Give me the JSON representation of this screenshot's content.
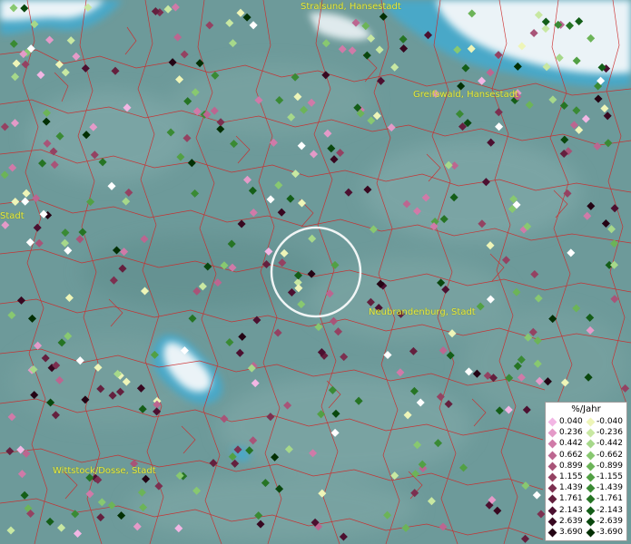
{
  "cities": [
    {
      "name": "Stralsund, Hansestadt"
    },
    {
      "name": "Greifswald, Hansestadt"
    },
    {
      "name": "Neubrandenburg, Stadt"
    },
    {
      "name": "Wittstock/Dosse, Stadt"
    },
    {
      "name": "Stadt"
    }
  ],
  "legend": {
    "title": "%/Jahr",
    "rows": [
      {
        "pos": "0.040",
        "neg": "-0.040",
        "pos_color": "#f2b6e4",
        "neg_color": "#eef5b8"
      },
      {
        "pos": "0.236",
        "neg": "-0.236",
        "pos_color": "#e49ac8",
        "neg_color": "#c8e8a2"
      },
      {
        "pos": "0.442",
        "neg": "-0.442",
        "pos_color": "#d07aa8",
        "neg_color": "#a6d88a"
      },
      {
        "pos": "0.662",
        "neg": "-0.662",
        "pos_color": "#bc6690",
        "neg_color": "#88c870"
      },
      {
        "pos": "0.899",
        "neg": "-0.899",
        "pos_color": "#a85478",
        "neg_color": "#6cb458"
      },
      {
        "pos": "1.155",
        "neg": "-1.155",
        "pos_color": "#944262",
        "neg_color": "#52a044"
      },
      {
        "pos": "1.439",
        "neg": "-1.439",
        "pos_color": "#7c3050",
        "neg_color": "#3a8a34"
      },
      {
        "pos": "1.761",
        "neg": "-1.761",
        "pos_color": "#64203e",
        "neg_color": "#267424"
      },
      {
        "pos": "2.143",
        "neg": "-2.143",
        "pos_color": "#4c1030",
        "neg_color": "#145e18"
      },
      {
        "pos": "2.639",
        "neg": "-2.639",
        "pos_color": "#380820",
        "neg_color": "#0a480e"
      },
      {
        "pos": "3.690",
        "neg": "-3.690",
        "pos_color": "#240414",
        "neg_color": "#033004"
      }
    ]
  },
  "palette": {
    "land": "#6d9a9a",
    "land_light": "#86adad",
    "boundary": "#cc2a2a",
    "water": "#4aa8c8",
    "cloud": "#f4f8fa",
    "label": "#e8e84a",
    "circle": "#ffffff"
  }
}
